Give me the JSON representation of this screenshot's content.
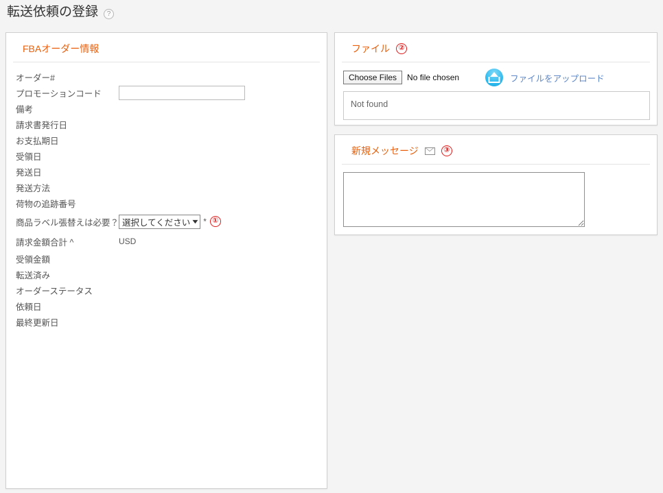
{
  "page": {
    "title": "転送依頼の登録",
    "help_icon": "help-circle-icon"
  },
  "order_panel": {
    "header": "FBAオーダー情報",
    "rows": [
      {
        "label": "オーダー#",
        "value": ""
      },
      {
        "label": "プロモーションコード",
        "value": "",
        "placeholder": ""
      },
      {
        "label": "備考",
        "value": ""
      },
      {
        "label": "請求書発行日",
        "value": ""
      },
      {
        "label": "お支払期日",
        "value": ""
      },
      {
        "label": "受領日",
        "value": ""
      },
      {
        "label": "発送日",
        "value": ""
      },
      {
        "label": "発送方法",
        "value": ""
      },
      {
        "label": "荷物の追跡番号",
        "value": ""
      },
      {
        "label": "商品ラベル張替えは必要？",
        "value": ""
      },
      {
        "label": "請求金額合計 ^",
        "value": "USD"
      },
      {
        "label": "受領金額",
        "value": ""
      },
      {
        "label": "転送済み",
        "value": ""
      },
      {
        "label": "オーダーステータス",
        "value": ""
      },
      {
        "label": "依頼日",
        "value": ""
      },
      {
        "label": "最終更新日",
        "value": ""
      }
    ],
    "relabel_select": {
      "selected": "選択してください",
      "required_mark": "*",
      "marker": "①"
    },
    "currency": "USD"
  },
  "file_panel": {
    "header": "ファイル",
    "marker": "②",
    "choose_button": "Choose Files",
    "no_file_text": "No file chosen",
    "upload_link": "ファイルをアップロード",
    "upload_icon": "upload-circle-icon",
    "list_empty_text": "Not found"
  },
  "message_panel": {
    "header": "新規メッセージ",
    "envelope_icon": "envelope-icon",
    "marker": "③",
    "textarea_value": "",
    "textarea_placeholder": ""
  },
  "colors": {
    "accent_orange": "#e8600d",
    "marker_red": "#e01b1b",
    "link_blue": "#5c86c7",
    "upload_cyan": "#35bdf0",
    "page_background": "#f4f4f4"
  }
}
